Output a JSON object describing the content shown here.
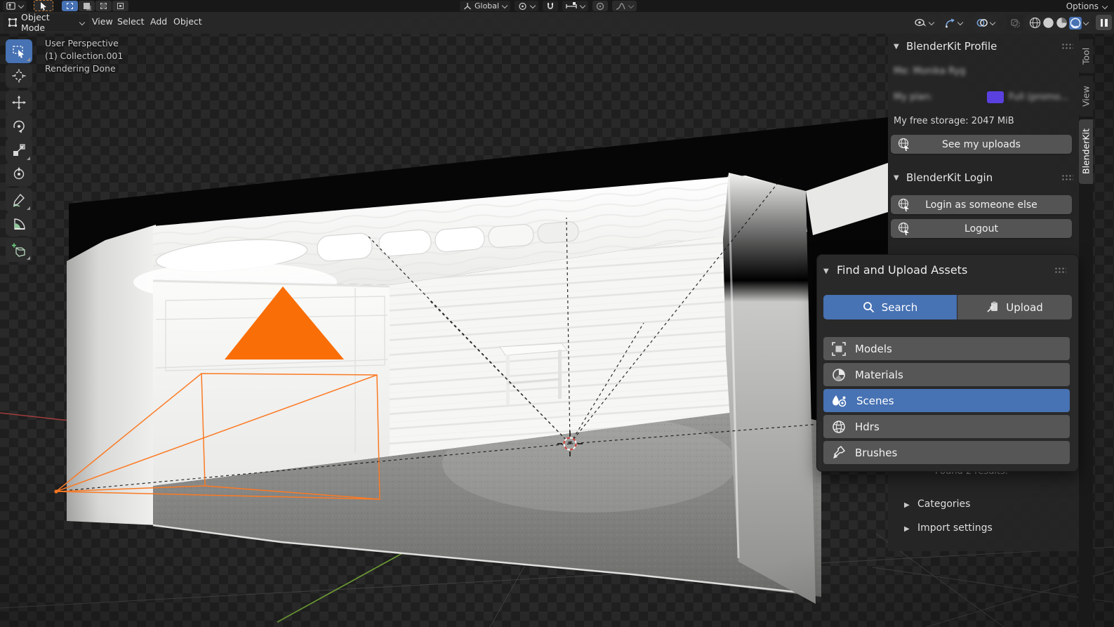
{
  "topbar": {
    "options_label": "Options",
    "orientation_value": "Global",
    "mode_select": "Object Mode",
    "menus": {
      "view": "View",
      "select": "Select",
      "add": "Add",
      "object": "Object"
    },
    "icons": [
      "editor-type-icon",
      "active-tool-cursor-icon",
      "select-mode-icons",
      "pivot-icon",
      "snap-magnet-icon",
      "snap-target-icon",
      "proportional-icon",
      "falloff-icon",
      "visibility-eye-icon",
      "gizmo-icon",
      "overlays-icon",
      "xray-icon",
      "shading-wireframe-icon",
      "shading-solid-icon",
      "shading-material-icon",
      "shading-rendered-icon",
      "pause-icon"
    ]
  },
  "viewport": {
    "overlay_line1": "User Perspective",
    "overlay_line2": "(1) Collection.001",
    "overlay_line3": "Rendering Done",
    "accent_orange": "#fb7a24",
    "select_blue": "#4772b3"
  },
  "toolbar_tools": [
    "select-box",
    "cursor",
    "move",
    "rotate",
    "scale",
    "transform",
    "annotate",
    "measure",
    "add-primitive"
  ],
  "sidebar": {
    "tabs": {
      "tool": "Tool",
      "view": "View",
      "blenderkit": "BlenderKit"
    },
    "active_tab": "BlenderKit",
    "profile": {
      "title": "BlenderKit Profile",
      "me_line": "Me: Monika Ryg",
      "plan_label": "My plan:",
      "plan_value": "Full (promo...",
      "plan_swatch_color": "#5b40e0",
      "storage_line": "My free storage: 2047 MiB",
      "uploads_button": "See my uploads"
    },
    "login": {
      "title": "BlenderKit Login",
      "login_button": "Login as someone else",
      "logout_button": "Logout"
    },
    "assets": {
      "title": "Find and Upload Assets",
      "search_tab": "Search",
      "upload_tab": "Upload",
      "types": [
        {
          "label": "Models",
          "icon": "models-icon",
          "selected": false
        },
        {
          "label": "Materials",
          "icon": "materials-icon",
          "selected": false
        },
        {
          "label": "Scenes",
          "icon": "scenes-icon",
          "selected": true
        },
        {
          "label": "Hdrs",
          "icon": "hdrs-icon",
          "selected": false
        },
        {
          "label": "Brushes",
          "icon": "brushes-icon",
          "selected": false
        }
      ],
      "results_line": "Found 2 results.",
      "categories_label": "Categories",
      "import_settings_label": "Import settings"
    }
  }
}
